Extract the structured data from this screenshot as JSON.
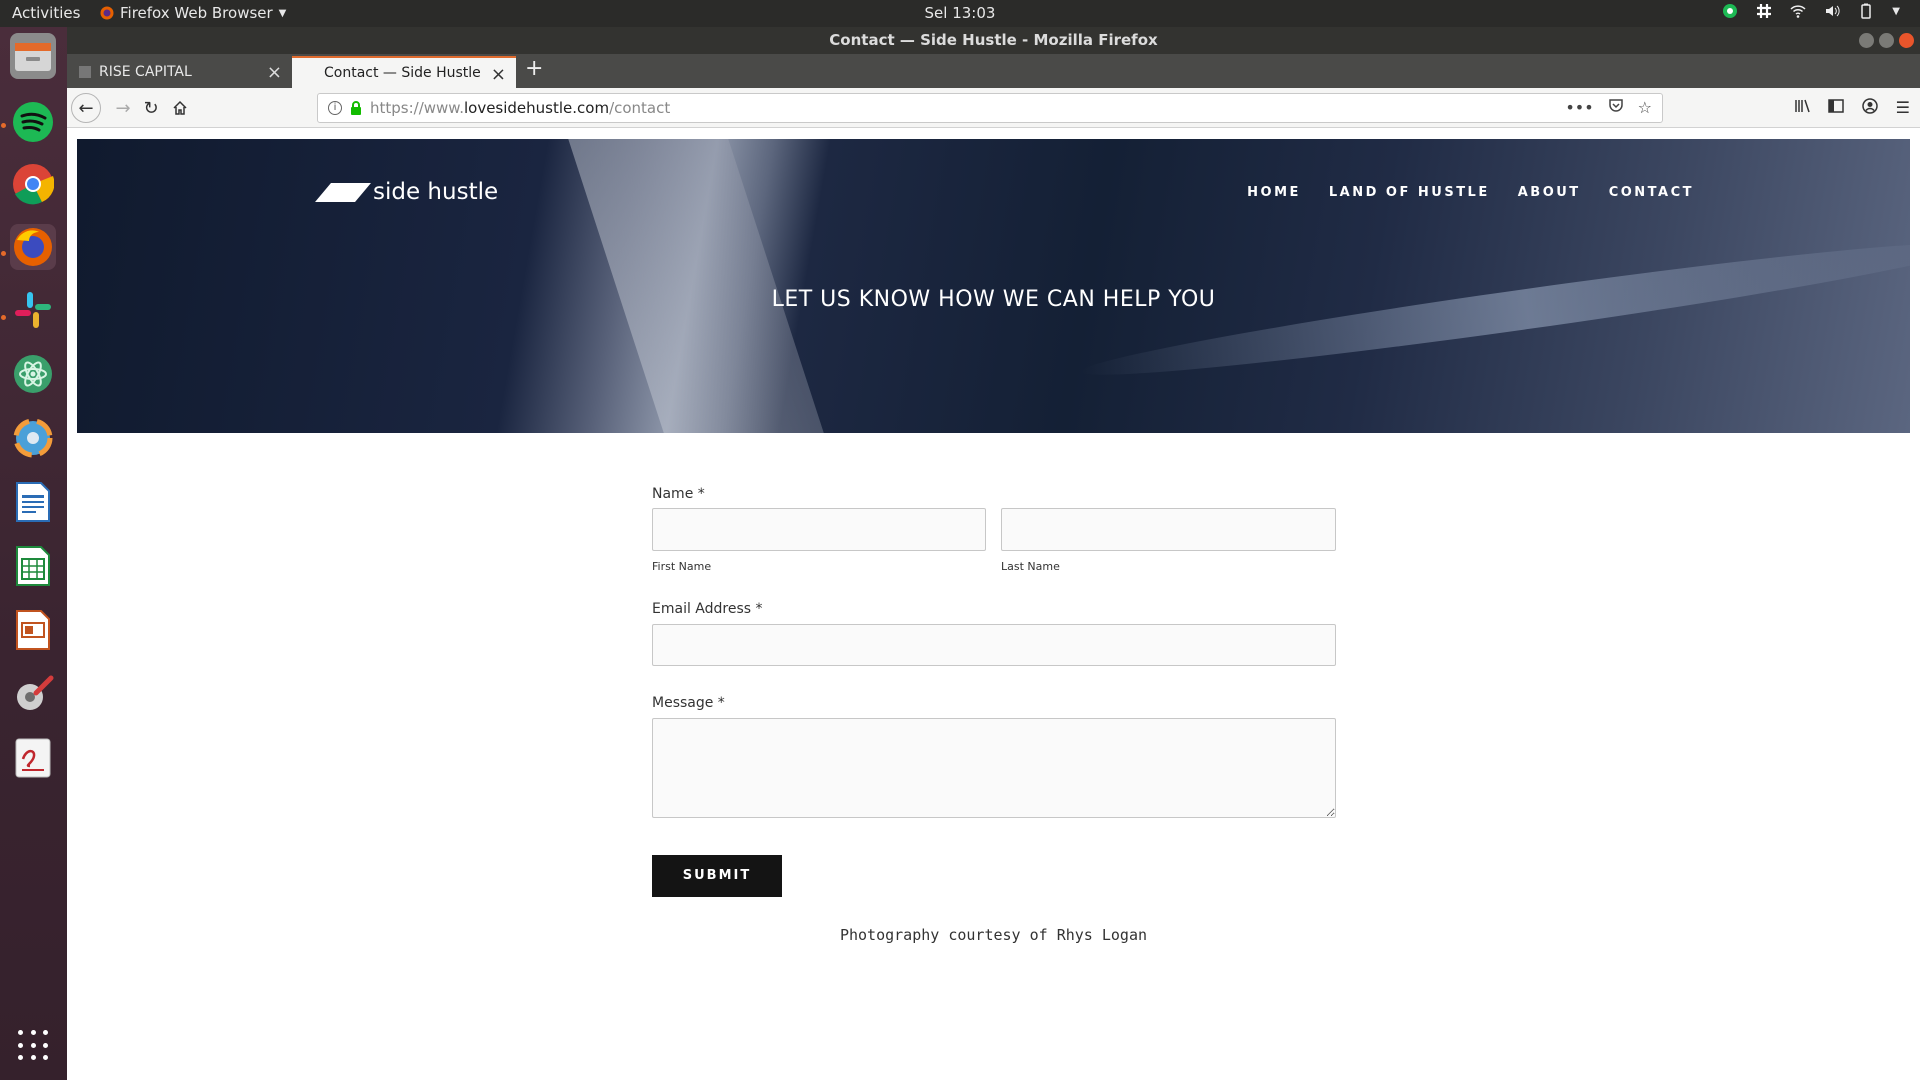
{
  "topbar": {
    "activities": "Activities",
    "app_name": "Firefox Web Browser",
    "clock": "Sel 13:03"
  },
  "window": {
    "title": "Contact — Side Hustle - Mozilla Firefox"
  },
  "tabs": [
    {
      "label": "RISE CAPITAL",
      "active": false
    },
    {
      "label": "Contact — Side Hustle",
      "active": true
    }
  ],
  "url": {
    "prefix": "https://www.",
    "domain": "lovesidehustle.com",
    "path": "/contact"
  },
  "dock": {
    "items": [
      "files-icon",
      "spotify-icon",
      "chrome-icon",
      "firefox-icon",
      "slack-icon",
      "atom-icon",
      "settings-update-icon",
      "writer-icon",
      "calc-icon",
      "impress-icon",
      "system-tools-icon",
      "document-viewer-icon"
    ]
  },
  "site": {
    "logo": "side hustle",
    "nav": [
      "HOME",
      "LAND OF HUSTLE",
      "ABOUT",
      "CONTACT"
    ],
    "hero_title": "LET US KNOW HOW WE CAN HELP YOU"
  },
  "form": {
    "name_label": "Name *",
    "first_name_label": "First Name",
    "last_name_label": "Last Name",
    "email_label": "Email Address *",
    "message_label": "Message *",
    "submit_label": "SUBMIT"
  },
  "footer": {
    "credit": "Photography courtesy of Rhys Logan"
  }
}
